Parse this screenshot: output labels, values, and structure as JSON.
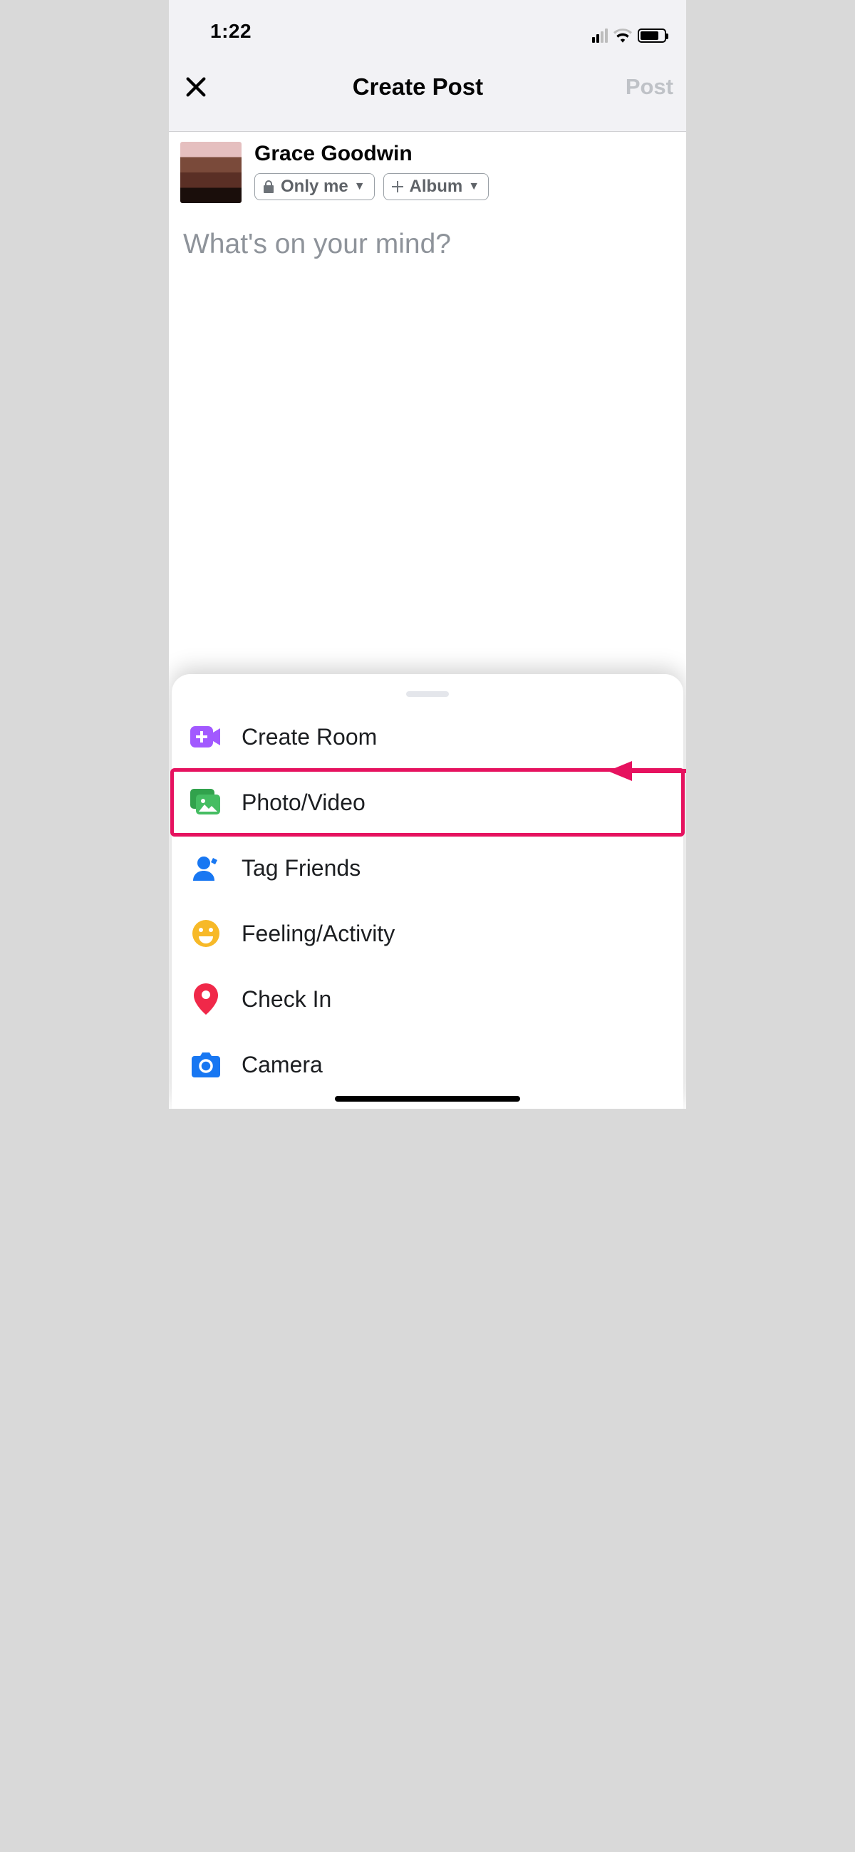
{
  "status_bar": {
    "time": "1:22"
  },
  "nav": {
    "title": "Create Post",
    "post_label": "Post"
  },
  "user": {
    "name": "Grace Goodwin"
  },
  "privacy_pill": {
    "label": "Only me"
  },
  "album_pill": {
    "label": "Album"
  },
  "composer": {
    "placeholder": "What's on your mind?"
  },
  "options": {
    "create_room": "Create Room",
    "photo_video": "Photo/Video",
    "tag_friends": "Tag Friends",
    "feeling_activity": "Feeling/Activity",
    "check_in": "Check In",
    "camera": "Camera"
  }
}
